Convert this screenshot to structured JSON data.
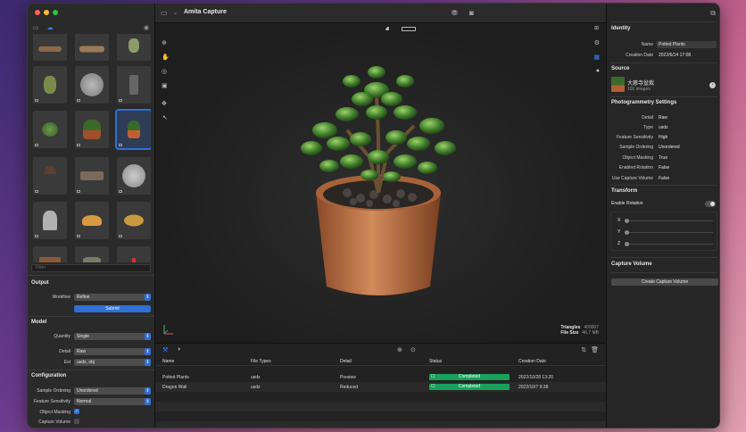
{
  "app": {
    "title": "Amita Capture"
  },
  "sidebar": {
    "filter_placeholder": "Filter",
    "output": {
      "title": "Output",
      "workflow_label": "Workflow",
      "workflow_value": "Refine",
      "submit_label": "Submit"
    },
    "model": {
      "title": "Model",
      "quantity_label": "Quantity",
      "quantity_value": "Single",
      "detail_label": "Detail",
      "detail_value": "Raw",
      "ext_label": "Ext",
      "ext_value": "usdz, obj"
    },
    "configuration": {
      "title": "Configuration",
      "sample_ordering_label": "Sample Ordering",
      "sample_ordering_value": "Unordered",
      "feature_sensitivity_label": "Feature Sensitivity",
      "feature_sensitivity_value": "Normal",
      "object_masking_label": "Object Masking",
      "capture_volume_label": "Capture Volume"
    }
  },
  "viewport": {
    "stats": {
      "triangles_label": "Triangles",
      "triangles_value": "400007",
      "file_size_label": "File Size",
      "file_size_value": "46.7 MB"
    }
  },
  "table": {
    "headers": [
      "Name",
      "File Types",
      "Detail",
      "Status",
      "Creation Date"
    ],
    "rows": [
      {
        "name": "Potted Plants",
        "file_type": "usdz",
        "detail": "Preview",
        "status": "Completed",
        "date": "2022/10/28 13:20"
      },
      {
        "name": "Dragon Wall",
        "file_type": "usdz",
        "detail": "Reduced",
        "status": "Completed",
        "date": "2022/10/7 9:38"
      }
    ]
  },
  "inspector": {
    "identity": {
      "title": "Identity",
      "name_label": "Name",
      "name_value": "Potted Plants",
      "creation_label": "Creation Date",
      "creation_value": "2022/6/14 17:08"
    },
    "source": {
      "title": "Source",
      "name": "大慈寺盆栽",
      "count": "100 images"
    },
    "photogrammetry": {
      "title": "Photogrammetry Settings",
      "rows": [
        {
          "label": "Detail",
          "value": "Raw"
        },
        {
          "label": "Type",
          "value": "usdz"
        },
        {
          "label": "Feature Sensitivity",
          "value": "High"
        },
        {
          "label": "Sample Ordering",
          "value": "Unordered"
        },
        {
          "label": "Object Masking",
          "value": "True"
        },
        {
          "label": "Enabled Rotation",
          "value": "False"
        },
        {
          "label": "Use Capture Volume",
          "value": "False"
        }
      ]
    },
    "transform": {
      "title": "Transform",
      "enable_rotation_label": "Enable Rotation",
      "axes": [
        "X",
        "Y",
        "Z"
      ]
    },
    "capture_volume": {
      "title": "Capture Volume",
      "create_label": "Create Capture Volume"
    }
  },
  "colors": {
    "accent": "#2f6fd6",
    "status_completed": "#1aa05a"
  }
}
